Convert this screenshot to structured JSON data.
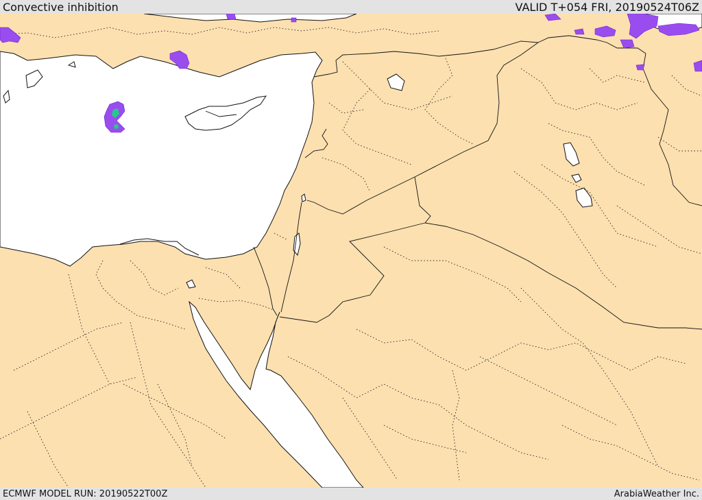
{
  "header": {
    "title": "Convective inhibition",
    "valid": "VALID T+054 FRI, 20190524T06Z"
  },
  "footer": {
    "model_run": "ECMWF MODEL RUN: 20190522T00Z",
    "credit": "ArabiaWeather Inc."
  },
  "colors": {
    "land": "#fde0b0",
    "water": "#ffffff",
    "cin_purple": "#9a4dee",
    "cin_green": "#22cc88"
  }
}
